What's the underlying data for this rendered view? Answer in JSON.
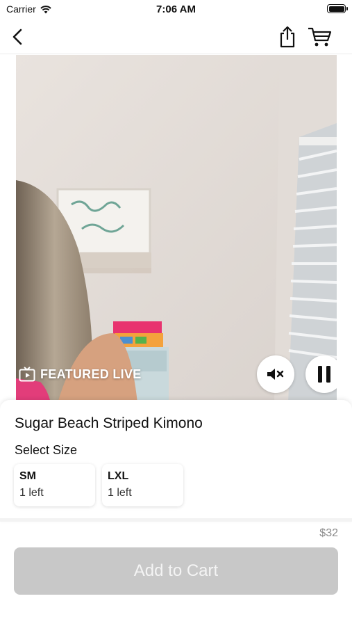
{
  "status_bar": {
    "carrier": "Carrier",
    "time": "7:06 AM"
  },
  "nav": {
    "back_icon": "chevron-left-icon",
    "share_icon": "share-icon",
    "cart_icon": "cart-icon"
  },
  "video": {
    "live_label": "FEATURED LIVE",
    "live_icon": "tv-play-icon",
    "mute_icon": "speaker-mute-icon",
    "pause_icon": "pause-icon"
  },
  "product": {
    "title": "Sugar Beach Striped Kimono",
    "select_size_label": "Select Size",
    "sizes": [
      {
        "name": "SM",
        "stock": "1 left"
      },
      {
        "name": "LXL",
        "stock": "1 left"
      }
    ],
    "price": "$32"
  },
  "actions": {
    "add_to_cart_label": "Add to Cart"
  },
  "colors": {
    "button_disabled": "#c8c8c8",
    "price": "#8a8a8a"
  }
}
